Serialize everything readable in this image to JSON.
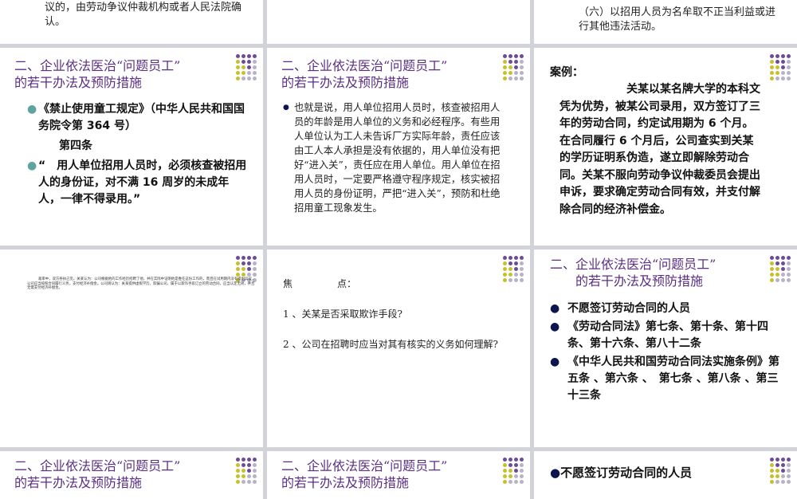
{
  "colors": {
    "title_purple": "#5b2e86",
    "bullet_teal": "#5fa3a0",
    "bullet_navy": "#0d1550",
    "dot_purple": "#6f4a9b",
    "dot_olive": "#c8c02a",
    "dot_gray": "#b8b2c8",
    "canvas": "#d2d3d8"
  },
  "icons": {
    "decor": "dot-grid-icon",
    "bullet": "round-bullet-icon"
  },
  "top_row": {
    "s1_text": "议的，由劳动争议仲裁机构或者人民法院确认。",
    "s2_text": "",
    "s3_text": "（六）以招用人员为名牟取不正当利益或进行其他违法活动。"
  },
  "common": {
    "title_line1": "二、企业依法医治“问题员工”",
    "title_line2": "的若干办法及预防措施"
  },
  "slide_a": {
    "items": [
      "《禁止使用童工规定》（中华人民共和国国务院令第 364 号）",
      "第四条",
      "“　用人单位招用人员时，必须核查被招用人的身份证，对不满 16 周岁的未成年人，一律不得录用。”"
    ]
  },
  "slide_b": {
    "item": "也就是说，用人单位招用人员时，核查被招用人员的年龄是用人单位的义务和必经程序。有些用人单位认为工人未告诉厂方实际年龄，责任应该由工人本人承担是没有依据的，用人单位没有把好“进入关”，责任应在用人单位。用人单位在招用人员时，一定要严格遵守程序规定，核实被招用人员的身份证明，严把“进入关”，预防和杜绝招用童工现象发生。"
  },
  "slide_c": {
    "label": "案例：",
    "body": "关某以某名牌大学的本科文凭为优势，被某公司录用，双方签订了三年的劳动合同，约定试用期为 6 个月。在合同履行 6 个月后，公司查实到关某的学历证明系伪造，遂立即解除劳动合同。关某不服向劳动争议仲裁委员会提出申诉，要求确定劳动合同有效，并支付解除合同的经济补偿金。"
  },
  "slide_d": {
    "tiny_text": "裁审中，双方各执己见。关某认为：公司根据他的工作经历招聘了他，并在实际中证明他是胜任这份工作的，而且在试用期内没有提出异议，公司应当按照合同履行义务，支付经济补偿金。公司则认为：关某提供虚假学历，欺骗公司，属于以欺诈手段订立的劳动合同，应当认定无效，并且无需支付经济补偿金。"
  },
  "slide_e": {
    "label_a": "焦",
    "label_b": "点：",
    "q1": "1 、关某是否采取欺诈手段?",
    "q2": "2 、公司在招聘时应当对其有核实的义务如何理解?"
  },
  "slide_f": {
    "items": [
      "不愿签订劳动合同的人员",
      "《劳动合同法》第七条、第十条、第十四条、第十六条、第八十二条",
      "《中华人民共和国劳动合同法实施条例》第五条 、第六条 、　第七条 、第八条 、第三十三条"
    ]
  },
  "bottom_row": {
    "s3_item": "不愿签订劳动合同的人员"
  }
}
